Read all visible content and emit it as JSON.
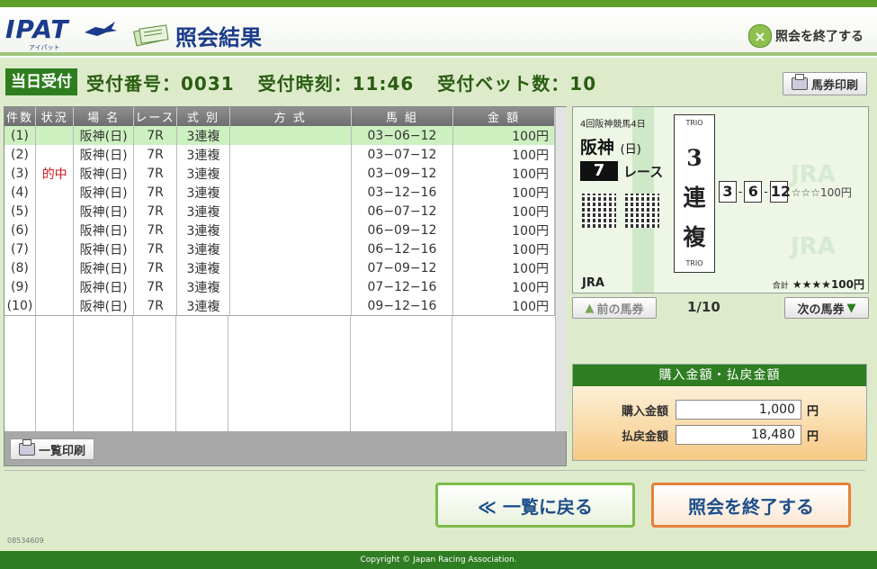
{
  "header": {
    "logo": "IPAT",
    "logo_sub": "アイパット",
    "title": "照会結果",
    "end_label": "照会を終了する"
  },
  "info": {
    "tag": "当日受付",
    "receipt_no": "受付番号：0031",
    "receipt_time": "受付時刻：11:46",
    "bet_count": "受付ベット数：10",
    "print_ticket": "馬券印刷"
  },
  "table": {
    "headers": [
      "件数",
      "状況",
      "場 名",
      "レース",
      "式 別",
      "方 式",
      "馬 組",
      "金 額"
    ],
    "rows": [
      {
        "no": "(1)",
        "status": "",
        "venue": "阪神(日)",
        "race": "7R",
        "type": "3連複",
        "method": "",
        "combo": "03−06−12",
        "amount": "100円"
      },
      {
        "no": "(2)",
        "status": "",
        "venue": "阪神(日)",
        "race": "7R",
        "type": "3連複",
        "method": "",
        "combo": "03−07−12",
        "amount": "100円"
      },
      {
        "no": "(3)",
        "status": "的中",
        "venue": "阪神(日)",
        "race": "7R",
        "type": "3連複",
        "method": "",
        "combo": "03−09−12",
        "amount": "100円"
      },
      {
        "no": "(4)",
        "status": "",
        "venue": "阪神(日)",
        "race": "7R",
        "type": "3連複",
        "method": "",
        "combo": "03−12−16",
        "amount": "100円"
      },
      {
        "no": "(5)",
        "status": "",
        "venue": "阪神(日)",
        "race": "7R",
        "type": "3連複",
        "method": "",
        "combo": "06−07−12",
        "amount": "100円"
      },
      {
        "no": "(6)",
        "status": "",
        "venue": "阪神(日)",
        "race": "7R",
        "type": "3連複",
        "method": "",
        "combo": "06−09−12",
        "amount": "100円"
      },
      {
        "no": "(7)",
        "status": "",
        "venue": "阪神(日)",
        "race": "7R",
        "type": "3連複",
        "method": "",
        "combo": "06−12−16",
        "amount": "100円"
      },
      {
        "no": "(8)",
        "status": "",
        "venue": "阪神(日)",
        "race": "7R",
        "type": "3連複",
        "method": "",
        "combo": "07−09−12",
        "amount": "100円"
      },
      {
        "no": "(9)",
        "status": "",
        "venue": "阪神(日)",
        "race": "7R",
        "type": "3連複",
        "method": "",
        "combo": "07−12−16",
        "amount": "100円"
      },
      {
        "no": "(10)",
        "status": "",
        "venue": "阪神(日)",
        "race": "7R",
        "type": "3連複",
        "method": "",
        "combo": "09−12−16",
        "amount": "100円"
      }
    ],
    "selected_row": 0,
    "print_list": "一覧印刷"
  },
  "ticket": {
    "meeting": "4回阪神競馬4日",
    "venue": "阪神",
    "day": "(日)",
    "race_no": "7",
    "race_label": "レース",
    "trio_top": "TRIO",
    "trio_bottom": "TRIO",
    "kind_chars": [
      "3",
      "連",
      "複"
    ],
    "horses": [
      "3",
      "6",
      "12"
    ],
    "line_amount": "☆☆☆100円",
    "jra": "JRA",
    "total_label": "合計",
    "total_amount": "★★★★100円",
    "watermark": "JRA"
  },
  "nav": {
    "prev": "前の馬券",
    "next": "次の馬券",
    "page": "1/10"
  },
  "amounts": {
    "title": "購入金額・払戻金額",
    "purchase_label": "購入金額",
    "purchase_value": "1,000",
    "payout_label": "払戻金額",
    "payout_value": "18,480",
    "unit": "円"
  },
  "buttons": {
    "back": "≪ 一覧に戻る",
    "end": "照会を終了する"
  },
  "code": "08534609",
  "footer": "Copyright © Japan Racing Association.",
  "colors": {
    "brand_green": "#2f7d22",
    "panel_bg": "#ddebcb",
    "hit_red": "#d01818",
    "logo_blue": "#1b3b8c"
  }
}
